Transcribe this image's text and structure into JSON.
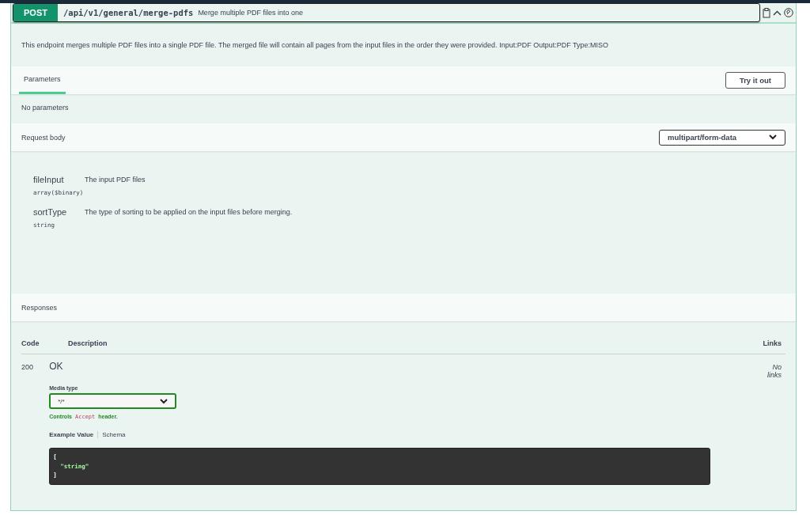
{
  "operation": {
    "method": "POST",
    "path": "/api/v1/general/merge-pdfs",
    "summary": "Merge multiple PDF files into one"
  },
  "description": "This endpoint merges multiple PDF files into a single PDF file. The merged file will contain all pages from the input files in the order they were provided. Input:PDF Output:PDF Type:MISO",
  "parameters_tabs": [
    {
      "label": "Parameters",
      "selected": true
    }
  ],
  "try_button": "Try it out",
  "no_parameters": "No parameters",
  "request_body": {
    "label": "Request body",
    "content_type": "multipart/form-data",
    "fields": [
      {
        "name": "fileInput",
        "type": "array($binary)",
        "description": "The input PDF files"
      },
      {
        "name": "sortType",
        "type": "string",
        "description": "The type of sorting to be applied on the input files before merging."
      }
    ]
  },
  "responses": {
    "title": "Responses",
    "columns": [
      "Code",
      "Description",
      "Links"
    ],
    "rows": [
      {
        "code": "200",
        "description": "OK",
        "links": "No links",
        "media_type_label": "Media type",
        "media_type": "*/*",
        "controls_note": [
          "Controls",
          "Accept",
          "header."
        ],
        "example_tabs": [
          {
            "label": "Example Value",
            "selected": true
          },
          {
            "label": "Schema",
            "selected": false
          }
        ],
        "example": "[\n  \"string\"\n]"
      }
    ]
  }
}
